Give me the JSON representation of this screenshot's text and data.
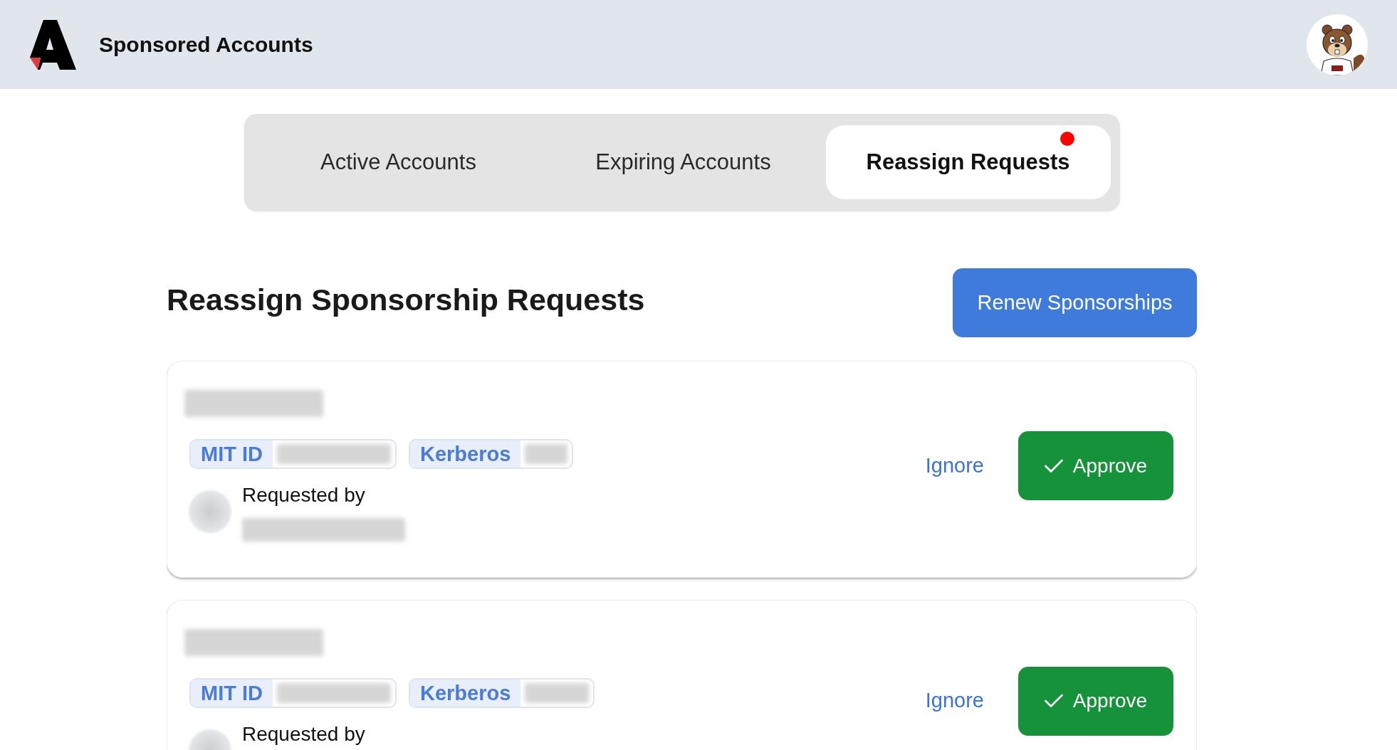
{
  "header": {
    "title": "Sponsored Accounts"
  },
  "tabs": [
    {
      "label": "Active Accounts",
      "selected": false,
      "notification": false
    },
    {
      "label": "Expiring Accounts",
      "selected": false,
      "notification": false
    },
    {
      "label": "Reassign Requests",
      "selected": true,
      "notification": true
    }
  ],
  "page": {
    "heading": "Reassign Sponsorship Requests",
    "renew_button": "Renew Sponsorships"
  },
  "requests": [
    {
      "name_redacted": true,
      "ids": [
        {
          "label": "MIT ID",
          "value_redacted": true
        },
        {
          "label": "Kerberos",
          "value_redacted": true
        }
      ],
      "requested_by": {
        "label": "Requested by",
        "name_redacted": true
      },
      "ignore": "Ignore",
      "approve": "Approve"
    },
    {
      "name_redacted": true,
      "ids": [
        {
          "label": "MIT ID",
          "value_redacted": true
        },
        {
          "label": "Kerberos",
          "value_redacted": true
        }
      ],
      "requested_by": {
        "label": "Requested by"
      },
      "ignore": "Ignore",
      "approve": "Approve"
    }
  ]
}
